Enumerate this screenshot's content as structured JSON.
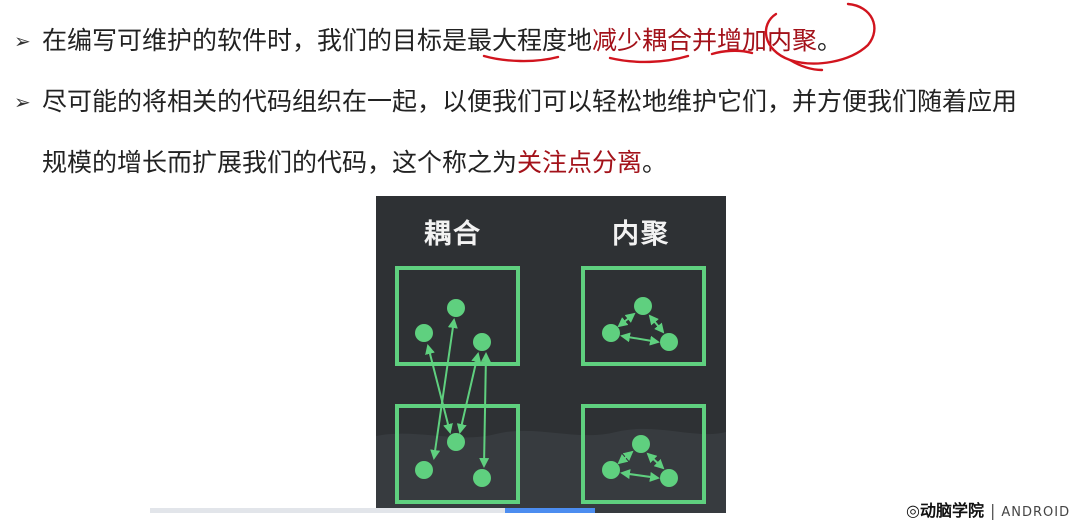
{
  "bullets": [
    {
      "segments": [
        {
          "text": "在编写可维护的软件时，我们的目标是",
          "color": "normal"
        },
        {
          "text": "最大程度地",
          "color": "normal"
        },
        {
          "text": "减少耦合并增加内聚",
          "color": "red"
        },
        {
          "text": "。",
          "color": "normal"
        }
      ]
    },
    {
      "line1": "尽可能的将相关的代码组织在一起，以便我们可以轻松地维护它们，并方便我们随着应用",
      "line2_prefix": "规模的增长而扩展我们的代码，这个称之为",
      "line2_red": "关注点分离",
      "line2_suffix": "。"
    }
  ],
  "diagram": {
    "left_title": "耦合",
    "right_title": "内聚",
    "colors": {
      "background": "#2e3134",
      "accent": "#5fd07f",
      "title": "#f2f2f2"
    }
  },
  "footer": {
    "logo_icon": "brand-circle-icon",
    "logo_text": "动脑学院",
    "logo_en": "ANDROID"
  },
  "colors": {
    "red_text": "#a3121a",
    "annotation_red": "#d1141e",
    "scroll_thumb": "#4c8df0"
  }
}
